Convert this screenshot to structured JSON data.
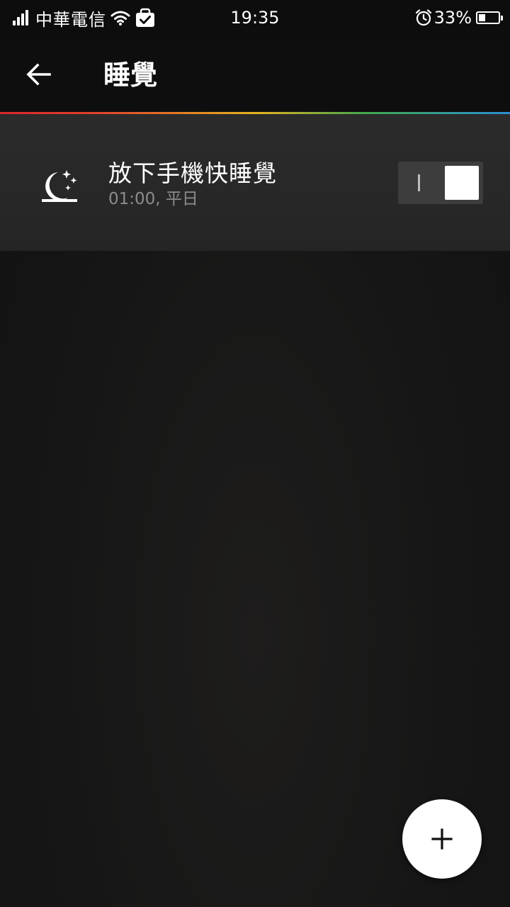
{
  "status_bar": {
    "carrier": "中華電信",
    "time": "19:35",
    "battery_percent_text": "33%",
    "battery_level": 0.33,
    "signal_icon": "signal-bars-icon",
    "wifi_icon": "wifi-icon",
    "notification_icon": "shopping-bag-check-icon",
    "alarm_icon": "alarm-clock-icon"
  },
  "toolbar": {
    "title": "睡覺",
    "back_icon": "arrow-left-icon"
  },
  "alarm": {
    "icon": "moon-stars-icon",
    "title": "放下手機快睡覺",
    "subtitle": "01:00, 平日",
    "enabled": true
  },
  "fab": {
    "icon": "plus-icon"
  },
  "colors": {
    "background": "#141414",
    "card": "#2a2a2a",
    "subtitle": "#8c8c8c",
    "accent_gradient": [
      "#d9262a",
      "#e8b220",
      "#3fa84e",
      "#2a8fd4"
    ]
  }
}
